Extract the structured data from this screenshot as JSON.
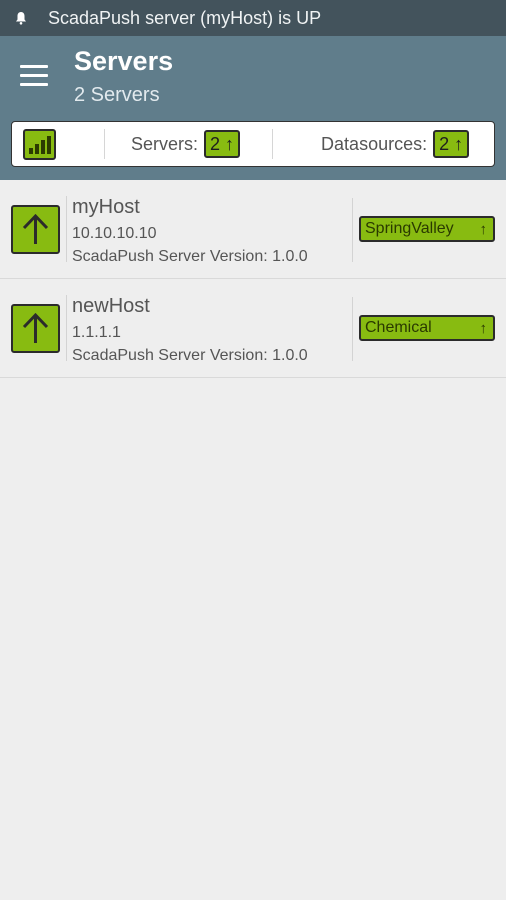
{
  "status_bar": {
    "icon": "bell-icon",
    "text": "ScadaPush server (myHost) is UP"
  },
  "app_bar": {
    "menu_icon": "hamburger-menu-icon",
    "title": "Servers",
    "subtitle": "2 Servers"
  },
  "summary": {
    "signal_icon": "signal-strength-icon",
    "servers_label": "Servers:",
    "servers_badge": "2 ↑",
    "datasources_label": "Datasources:",
    "datasources_badge": "2 ↑"
  },
  "servers": [
    {
      "host": "myHost",
      "ip": "10.10.10.10",
      "version": "ScadaPush Server Version: 1.0.0",
      "status_icon": "arrow-up-icon",
      "datasource": "SpringValley",
      "datasource_arrow": "↑"
    },
    {
      "host": "newHost",
      "ip": "1.1.1.1",
      "version": "ScadaPush Server Version: 1.0.0",
      "status_icon": "arrow-up-icon",
      "datasource": "Chemical",
      "datasource_arrow": "↑"
    }
  ],
  "colors": {
    "status_bar": "#43535c",
    "app_bar": "#607d8b",
    "accent_green": "#88bb11",
    "background": "#eeeeee"
  }
}
